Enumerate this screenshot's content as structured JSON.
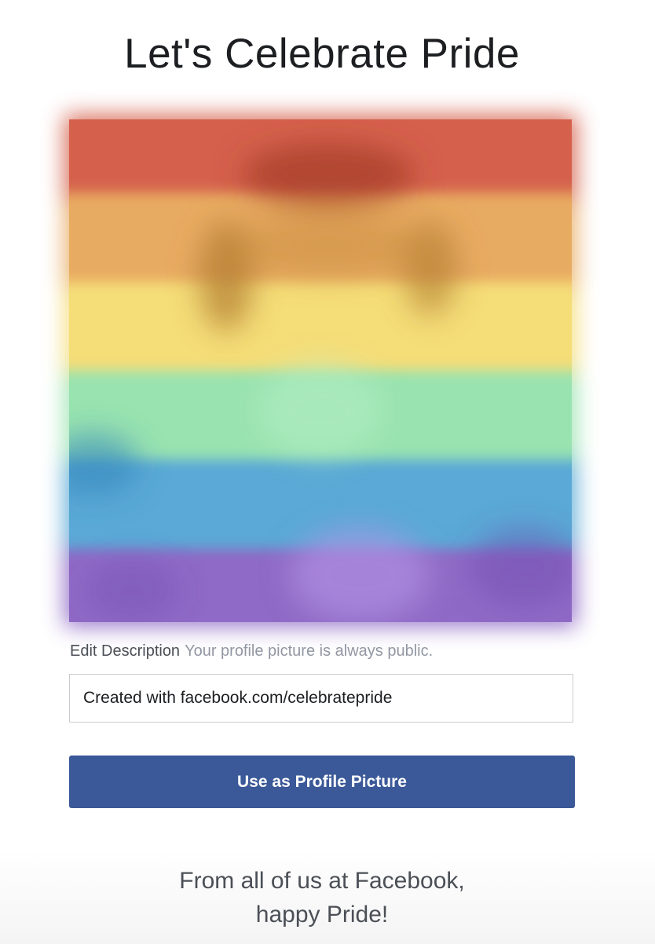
{
  "header": {
    "title": "Let's Celebrate Pride"
  },
  "profile_photo": {
    "overlay": "rainbow-flag",
    "stripe_colors": [
      "#d5614d",
      "#e8ab62",
      "#f5dd78",
      "#99e3b0",
      "#5aa9d6",
      "#8f6ac6"
    ]
  },
  "description": {
    "label": "Edit Description",
    "note": "Your profile picture is always public.",
    "value": "Created with facebook.com/celebratepride"
  },
  "actions": {
    "use_profile_picture": "Use as Profile Picture"
  },
  "footer": {
    "line1": "From all of us at Facebook,",
    "line2": "happy Pride!"
  },
  "colors": {
    "button": "#3b5998",
    "text_dark": "#1c1e21",
    "text_muted": "#9197a3"
  }
}
